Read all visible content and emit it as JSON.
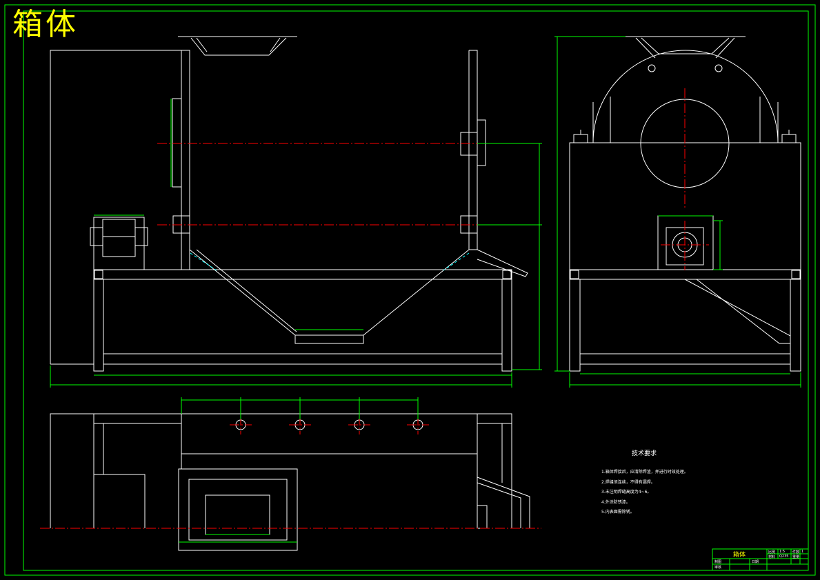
{
  "drawing": {
    "title": "箱体",
    "colors": {
      "background": "#000000",
      "frame": "#00ff00",
      "outline": "#ffffff",
      "centerline": "#ff0000",
      "dimension": "#00ff00",
      "hidden": "#00ffff",
      "title": "#ffff00"
    }
  },
  "technical_requirements": {
    "heading": "技术要求",
    "notes": [
      "1.箱体焊接后，应清除焊渣，并进行时效处理。",
      "2.焊缝须连续，不得有漏焊。",
      "3.未注明焊缝高度为4~6。",
      "4.外涂防锈漆。",
      "5.内表面需除锈。"
    ]
  },
  "title_block": {
    "part_name": "箱体",
    "cells": [
      "比例",
      "1:5",
      "件数",
      "1",
      "材料",
      "Q235",
      "重量",
      "",
      "制图",
      "审核",
      "日期"
    ]
  }
}
